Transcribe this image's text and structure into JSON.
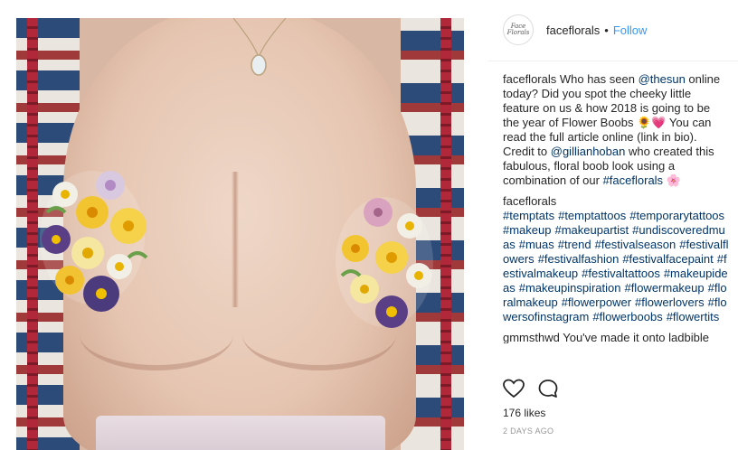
{
  "post": {
    "username": "faceflorals",
    "separator": "•",
    "follow_label": "Follow",
    "avatar_text": "Face Florals"
  },
  "caption": {
    "username": "faceflorals",
    "text_1": " Who has seen ",
    "mention_1": "@thesun",
    "text_2": " online today? Did you spot the cheeky little feature on us & how 2018 is going to be the year of Flower Boobs ",
    "emoji_1": "🌻💗",
    "text_3": " You can read the full article online (link in bio). Credit to ",
    "mention_2": "@gillianhoban",
    "text_4": " who created this fabulous, floral boob look using a combination of our ",
    "hashtag_1": "#faceflorals",
    "emoji_2": " 🌸"
  },
  "hashtag_comment": {
    "username": "faceflorals",
    "tags": [
      "#temptats",
      "#temptattoos",
      "#temporarytattoos",
      "#makeup",
      "#makeupartist",
      "#undiscoveredmuas",
      "#muas",
      "#trend",
      "#festivalseason",
      "#festivalflowers",
      "#festivalfashion",
      "#festivalfacepaint",
      "#festivalmakeup",
      "#festivaltattoos",
      "#makeupideas",
      "#makeupinspiration",
      "#flowermakeup",
      "#floralmakeup",
      "#flowerpower",
      "#flowerlovers",
      "#flowersofinstagram",
      "#flowerboobs",
      "#flowertits"
    ]
  },
  "partial_comment": {
    "username": "gmmsthwd",
    "text": " You've made it onto ladbible"
  },
  "stats": {
    "likes": "176 likes",
    "timestamp": "2 DAYS AGO"
  },
  "icons": {
    "like": "heart-icon",
    "comment": "comment-bubble-icon"
  },
  "colors": {
    "link": "#003569",
    "follow": "#3897f0",
    "muted": "#999999"
  }
}
